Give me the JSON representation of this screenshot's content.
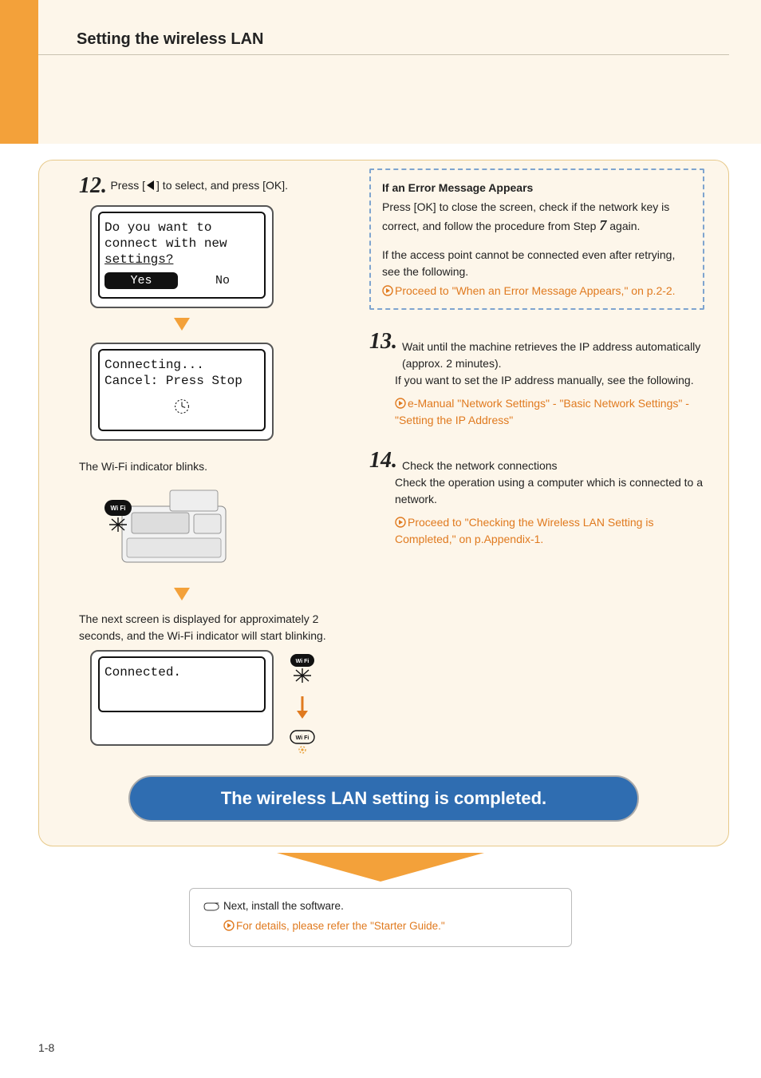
{
  "header": {
    "section_title": "Setting the wireless LAN"
  },
  "step12": {
    "num": "12.",
    "text_before": "Press [",
    "text_after": "] to select, and press [OK].",
    "lcd_prompt_l1": "Do you want to",
    "lcd_prompt_l2": "connect with new",
    "lcd_prompt_l3": "settings?",
    "yes": "Yes",
    "no": "No",
    "lcd_connecting_l1": "Connecting...",
    "lcd_connecting_l2": "Cancel: Press Stop",
    "wifi_blinks": "The Wi-Fi indicator blinks.",
    "next_screen": "The next screen is displayed for approximately 2 seconds, and the Wi-Fi indicator will start blinking.",
    "lcd_connected": "Connected."
  },
  "callout": {
    "title": "If an Error Message Appears",
    "body1a": "Press [OK] to close the screen, check if the network key is correct, and follow the procedure from Step ",
    "step_ref": "7",
    "body1b": " again.",
    "body2": "If the access point cannot be connected even after retrying, see the following.",
    "link": "Proceed to \"When an Error Message Appears,\" on p.2-2."
  },
  "step13": {
    "num": "13.",
    "line1": "Wait until the machine retrieves the IP address automatically (approx. 2 minutes).",
    "line2": "If you want to set the IP address manually, see the following.",
    "link": "e-Manual \"Network Settings\" - \"Basic Network Settings\" - \"Setting the IP Address\""
  },
  "step14": {
    "num": "14.",
    "line1": "Check the network connections",
    "line2": "Check the operation using a computer which is connected to a network.",
    "link": "Proceed to \"Checking the Wireless LAN Setting is Completed,\" on p.Appendix-1."
  },
  "pill": "The wireless LAN setting is completed.",
  "bottom_note": {
    "line1": "Next, install the software.",
    "link": "For details, please refer the \"Starter Guide.\""
  },
  "page_number": "1-8"
}
